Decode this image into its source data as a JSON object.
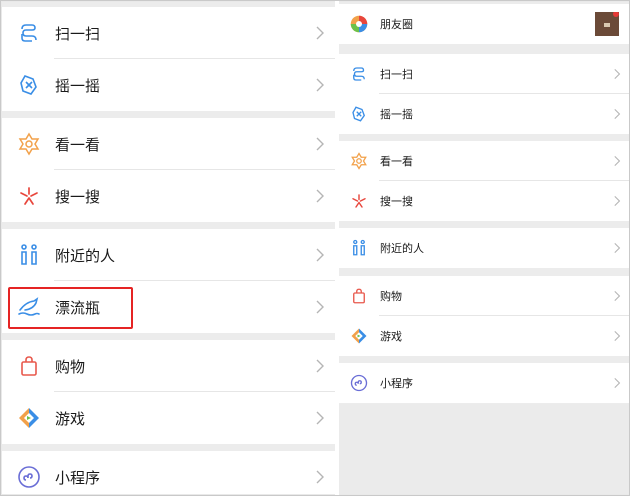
{
  "left_panel": {
    "items": [
      {
        "label": "扫一扫"
      },
      {
        "label": "摇一摇"
      },
      {
        "label": "看一看"
      },
      {
        "label": "搜一搜"
      },
      {
        "label": "附近的人"
      },
      {
        "label": "漂流瓶"
      },
      {
        "label": "购物"
      },
      {
        "label": "游戏"
      },
      {
        "label": "小程序"
      }
    ]
  },
  "right_panel": {
    "items": [
      {
        "label": "朋友圈"
      },
      {
        "label": "扫一扫"
      },
      {
        "label": "摇一摇"
      },
      {
        "label": "看一看"
      },
      {
        "label": "搜一搜"
      },
      {
        "label": "附近的人"
      },
      {
        "label": "购物"
      },
      {
        "label": "游戏"
      },
      {
        "label": "小程序"
      }
    ]
  },
  "colors": {
    "highlight": "#e52424",
    "scan_icon": "#3a8ee6",
    "look_icon": "#f2a14a",
    "search_icon": "#e8463c",
    "nearby_icon": "#3a8ee6",
    "bottle_icon": "#3a8ee6",
    "shop_icon": "#e8584c",
    "miniapp_icon": "#6a6ed6"
  }
}
